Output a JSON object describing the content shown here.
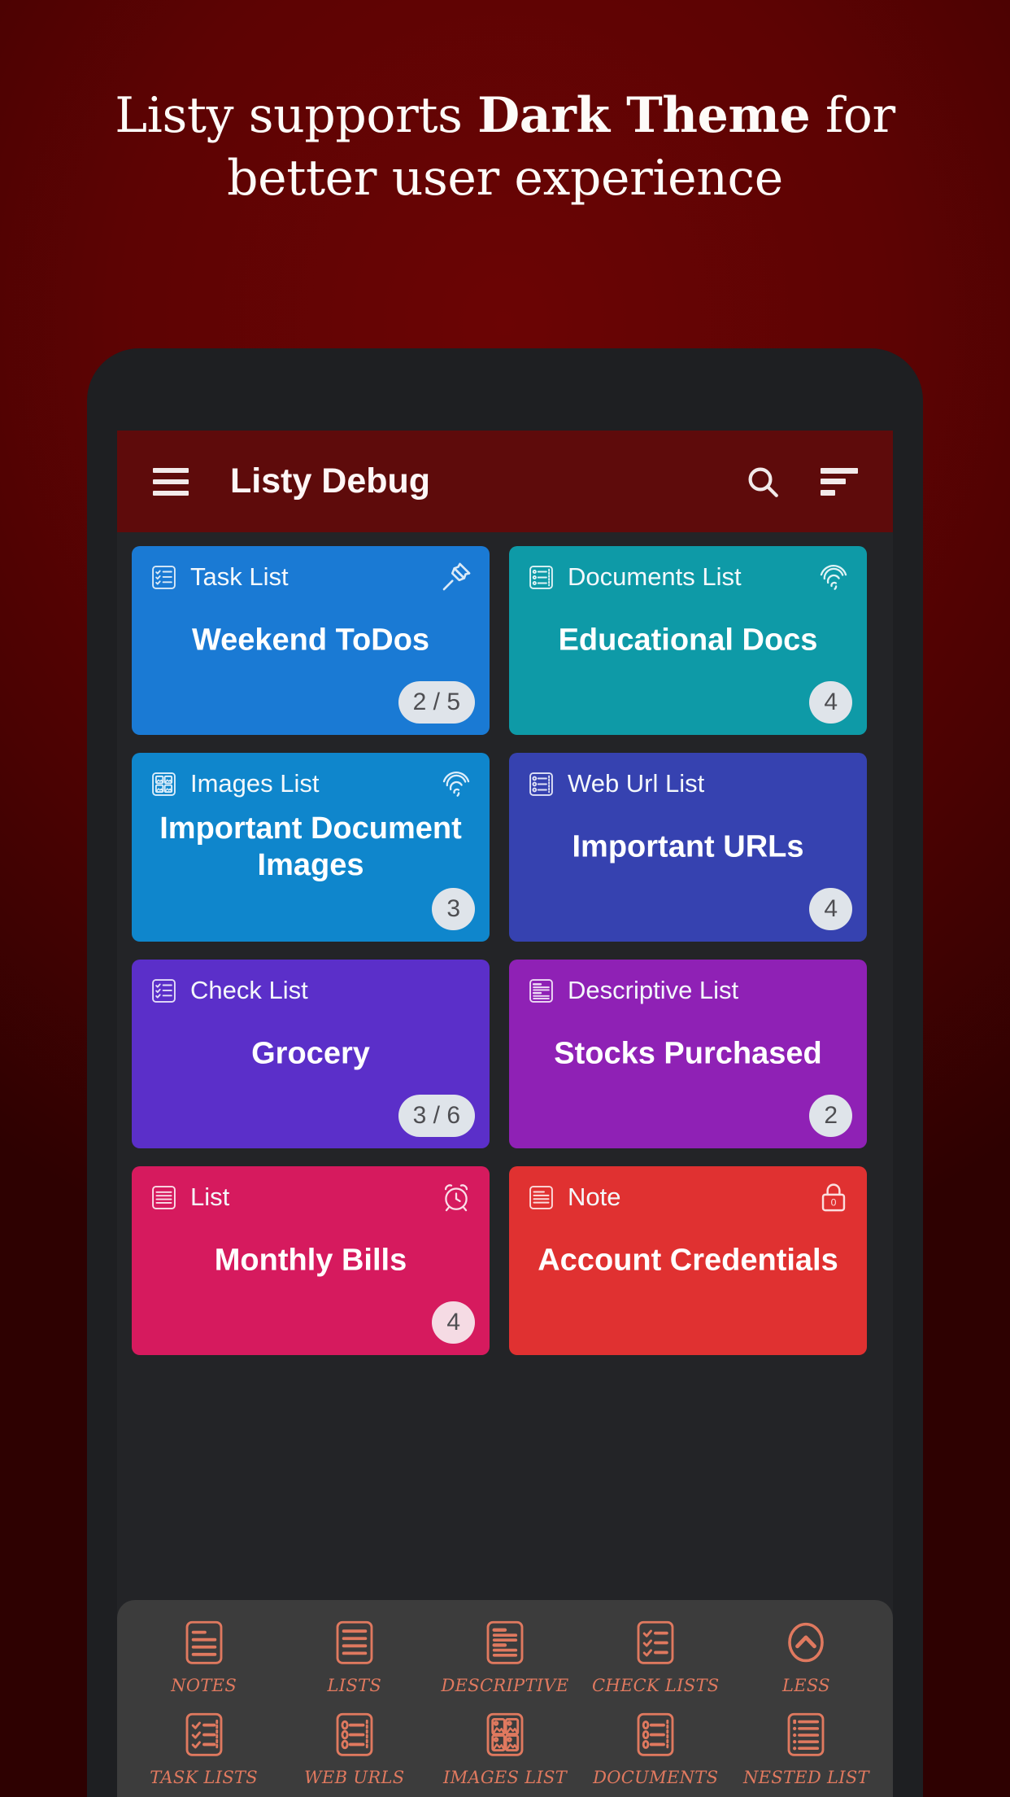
{
  "promo": {
    "headline_line1_plain": "Listy supports ",
    "headline_line1_bold": "Dark Theme",
    "headline_line1_tail": " for",
    "headline_line2": "better user experience",
    "background_color": "#5e0303"
  },
  "appbar": {
    "menu_icon": "hamburger-menu-icon",
    "title": "Listy Debug",
    "search_icon": "search-icon",
    "sort_icon": "sort-icon",
    "background_color": "#5e0b0b"
  },
  "cards": [
    {
      "type": "Task List",
      "title": "Weekend ToDos",
      "badge": "2 / 5",
      "color": "#1a7ad4",
      "type_icon": "task-list-icon",
      "corner_icon": "pin-icon",
      "badge_style": "grey"
    },
    {
      "type": "Documents List",
      "title": "Educational Docs",
      "badge": "4",
      "color": "#0e9aa7",
      "type_icon": "documents-list-icon",
      "corner_icon": "fingerprint-icon",
      "badge_style": "grey"
    },
    {
      "type": "Images List",
      "title": "Important Document Images",
      "badge": "3",
      "color": "#0f86cc",
      "type_icon": "images-list-icon",
      "corner_icon": "fingerprint-icon",
      "badge_style": "grey"
    },
    {
      "type": "Web Url List",
      "title": "Important URLs",
      "badge": "4",
      "color": "#3642b0",
      "type_icon": "web-url-list-icon",
      "corner_icon": "none",
      "badge_style": "grey"
    },
    {
      "type": "Check List",
      "title": "Grocery",
      "badge": "3 / 6",
      "color": "#5b2fc9",
      "type_icon": "check-list-icon",
      "corner_icon": "none",
      "badge_style": "grey"
    },
    {
      "type": "Descriptive List",
      "title": "Stocks Purchased",
      "badge": "2",
      "color": "#8f21b5",
      "type_icon": "descriptive-list-icon",
      "corner_icon": "none",
      "badge_style": "grey"
    },
    {
      "type": "List",
      "title": "Monthly Bills",
      "badge": "4",
      "color": "#d61a5e",
      "type_icon": "list-icon",
      "corner_icon": "alarm-clock-icon",
      "badge_style": "pink"
    },
    {
      "type": "Note",
      "title": "Account Credentials",
      "badge": "",
      "color": "#e03131",
      "type_icon": "note-icon",
      "corner_icon": "lock-icon",
      "lock_count": "0",
      "badge_style": "none"
    }
  ],
  "bottom_bar": {
    "accent_color": "#e0795f",
    "background_color": "#3c3c3c",
    "row1": [
      {
        "label": "NOTES",
        "icon": "note-icon"
      },
      {
        "label": "LISTS",
        "icon": "list-icon"
      },
      {
        "label": "DESCRIPTIVE",
        "icon": "descriptive-list-icon"
      },
      {
        "label": "CHECK LISTS",
        "icon": "check-list-icon"
      },
      {
        "label": "LESS",
        "icon": "chevron-up-circle-icon"
      }
    ],
    "row2": [
      {
        "label": "TASK LISTS",
        "icon": "task-list-icon"
      },
      {
        "label": "WEB URLS",
        "icon": "web-url-list-icon"
      },
      {
        "label": "IMAGES LIST",
        "icon": "images-list-icon"
      },
      {
        "label": "DOCUMENTS",
        "icon": "documents-list-icon"
      },
      {
        "label": "NESTED LIST",
        "icon": "nested-list-icon"
      }
    ]
  }
}
